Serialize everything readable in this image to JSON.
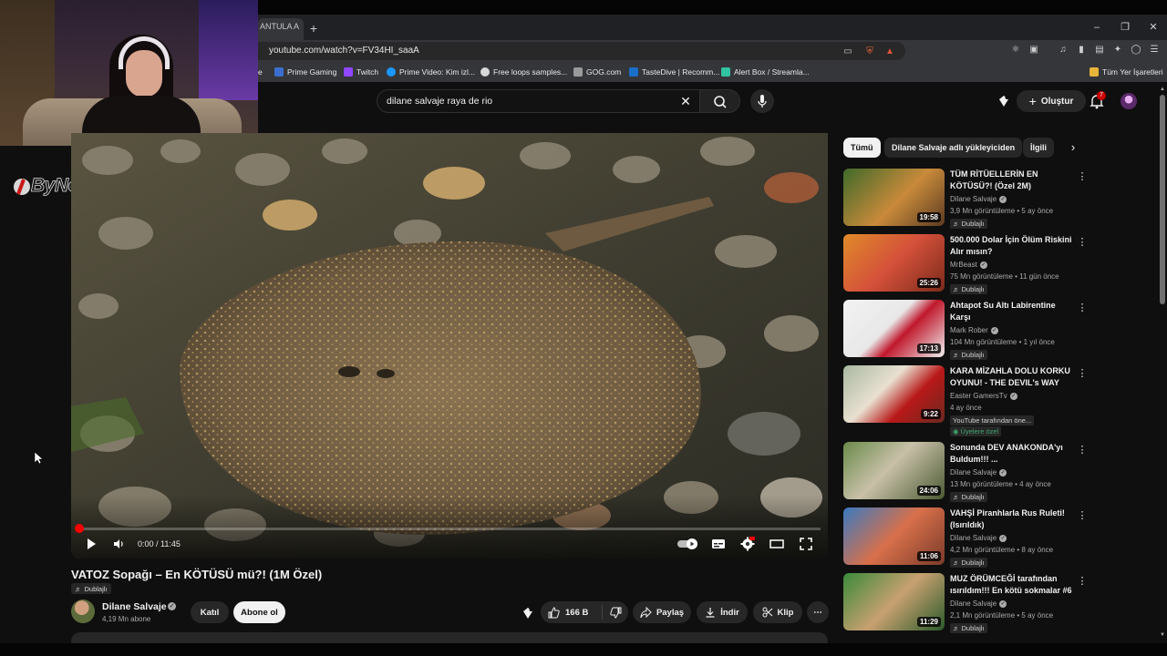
{
  "browser": {
    "tab_partial": "ANTULA A",
    "new_tab": "+",
    "url": "youtube.com/watch?v=FV34HI_saaA",
    "bookmarks": [
      {
        "label": "e",
        "icon": "#888888"
      },
      {
        "label": "Prime Gaming",
        "icon": "#9146ff"
      },
      {
        "label": "Twitch",
        "icon": "#9146ff"
      },
      {
        "label": "Prime Video: Kim izl...",
        "icon": "#1a98ff"
      },
      {
        "label": "Free loops samples...",
        "icon": "#dddddd"
      },
      {
        "label": "GOG.com",
        "icon": "#bbbbbb"
      },
      {
        "label": "TasteDive | Recomm...",
        "icon": "#1a6fc9"
      },
      {
        "label": "Alert Box / Streamla...",
        "icon": "#31c3a2"
      },
      {
        "label": "Tüm Yer İşaretleri",
        "icon": "#e8b53b"
      }
    ]
  },
  "youtube": {
    "search_query": "dilane salvaje raya de rio",
    "create_label": "Oluştur",
    "notification_count": "7"
  },
  "watermark": "ByNoGame",
  "player": {
    "time": "0:00 / 11:45",
    "progress": 0.0
  },
  "video": {
    "title": "VATOZ Sopağı – En KÖTÜSÜ mü?! (1M Özel)",
    "dub_label": "Dublajlı",
    "channel_name": "Dilane Salvaje",
    "subscribers": "4,19 Mn abone",
    "join_label": "Katıl",
    "subscribe_label": "Abone ol",
    "likes": "166 B",
    "share_label": "Paylaş",
    "download_label": "İndir",
    "clip_label": "Klip"
  },
  "chips": [
    "Tümü",
    "Dilane Salvaje adlı yükleyiciden",
    "İlgili"
  ],
  "recommendations": [
    {
      "title": "TÜM RİTÜELLERİN EN KÖTÜSÜ?! (Özel 2M)",
      "channel": "Dilane Salvaje",
      "verified": true,
      "meta": "3,9 Mn görüntüleme • 5 ay önce",
      "badge": "Dublajlı",
      "duration": "19:58",
      "thumb": "linear-gradient(135deg,#3f6a2a,#c98a3a 55%,#5b3b22)"
    },
    {
      "title": "500.000 Dolar İçin Ölüm Riskini Alır mısın?",
      "channel": "MrBeast",
      "verified": true,
      "meta": "75 Mn görüntüleme • 11 gün önce",
      "badge": "Dublajlı",
      "duration": "25:26",
      "thumb": "linear-gradient(135deg,#e08a2a,#d4503a 50%,#7a2a1a)"
    },
    {
      "title": "Ahtapot Su Altı Labirentine Karşı",
      "channel": "Mark Rober",
      "verified": true,
      "meta": "104 Mn görüntüleme • 1 yıl önce",
      "badge": "Dublajlı",
      "duration": "17:13",
      "thumb": "linear-gradient(135deg,#f2f2f2,#e8e8e8 45%,#c0182c 60%,#f0f0f0)"
    },
    {
      "title": "KARA MİZAHLA DOLU KORKU OYUNU! - THE DEVIL's WAY",
      "channel": "Easter GamersTv",
      "verified": true,
      "meta": "4 ay önce",
      "badge": "YouTube tarafından öne...",
      "badge2": "Üyelere özel",
      "duration": "9:22",
      "thumb": "linear-gradient(135deg,#a8b8a0,#e8e0d0 40%,#b81818 65%,#6a2a20)"
    },
    {
      "title": "Sonunda DEV ANAKONDA'yı Buldum!!! ...",
      "channel": "Dilane Salvaje",
      "verified": true,
      "meta": "13 Mn görüntüleme • 4 ay önce",
      "badge": "Dublajlı",
      "duration": "24:06",
      "thumb": "linear-gradient(135deg,#6a8a4a,#c8c0a8 45%,#4a5a32)"
    },
    {
      "title": "VAHŞİ Piranhlarla Rus Ruleti! (Isırıldık)",
      "channel": "Dilane Salvaje",
      "verified": true,
      "meta": "4,2 Mn görüntüleme • 8 ay önce",
      "badge": "Dublajlı",
      "duration": "11:06",
      "thumb": "linear-gradient(135deg,#3a7ac0,#d8704a 50%,#7a3a2a)"
    },
    {
      "title": "MUZ ÖRÜMCEĞİ tarafından ısırıldım!!! En kötü sokmalar #6",
      "channel": "Dilane Salvaje",
      "verified": true,
      "meta": "2,1 Mn görüntüleme • 5 ay önce",
      "badge": "Dublajlı",
      "duration": "11:29",
      "thumb": "linear-gradient(135deg,#3a8a3a,#c8a070 50%,#2a5a2a)"
    }
  ],
  "icons": {
    "tab_new": "plus-icon",
    "window_min": "minimize-icon",
    "window_max": "restore-icon",
    "window_close": "close-icon",
    "search": "search-icon",
    "mic": "mic-icon",
    "create": "plus-icon",
    "bell": "bell-icon"
  },
  "colors": {
    "youtube_red": "#ff0000",
    "background": "#0f0f0f",
    "chip": "#272727",
    "membership_green": "#3ea66f"
  }
}
